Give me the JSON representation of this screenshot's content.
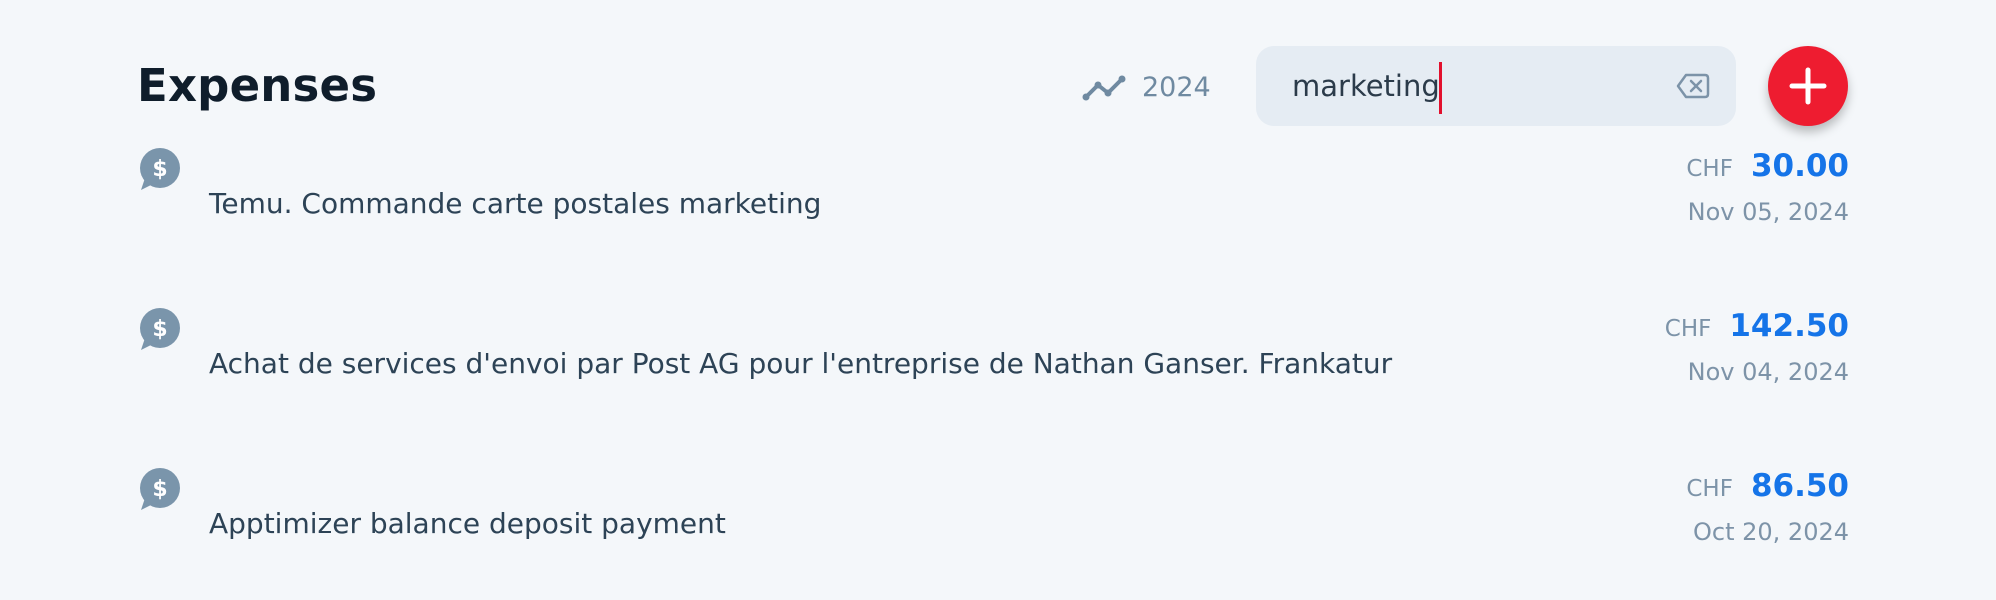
{
  "header": {
    "title": "Expenses",
    "year": "2024",
    "search_value": "marketing",
    "icons": {
      "trend": "trend-line-icon",
      "clear": "backspace-clear-icon",
      "add": "plus-icon"
    }
  },
  "colors": {
    "background": "#f4f7fa",
    "title": "#0f1d2b",
    "muted": "#7c93a8",
    "amount": "#1574e8",
    "accent_red": "#ee1c30",
    "search_bg": "#e5ecf3",
    "category_icon": "#7a95ab"
  },
  "expenses": [
    {
      "icon": "dollar-chat-icon",
      "description": "Temu. Commande carte postales marketing",
      "currency": "CHF",
      "amount": "30.00",
      "date": "Nov 05, 2024"
    },
    {
      "icon": "dollar-chat-icon",
      "description": "Achat de services d'envoi par Post AG pour l'entreprise de Nathan Ganser. Frankatur",
      "currency": "CHF",
      "amount": "142.50",
      "date": "Nov 04, 2024"
    },
    {
      "icon": "dollar-chat-icon",
      "description": "Apptimizer balance deposit payment",
      "currency": "CHF",
      "amount": "86.50",
      "date": "Oct 20, 2024"
    }
  ]
}
